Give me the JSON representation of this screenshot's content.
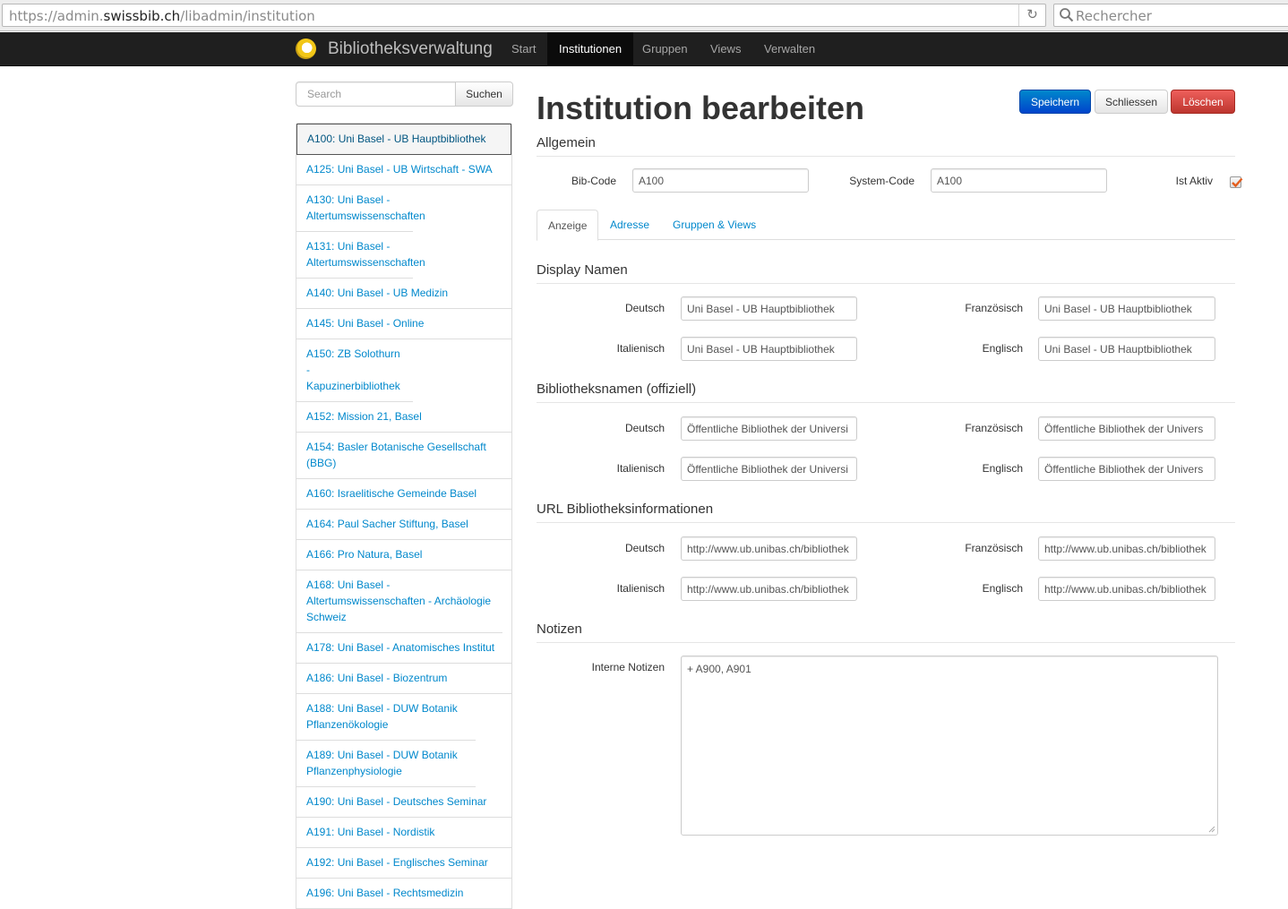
{
  "browser": {
    "url_prefix": "https://admin.",
    "url_host": "swissbib.ch",
    "url_path": "/libadmin/institution",
    "search_placeholder": "Rechercher"
  },
  "navbar": {
    "brand": "Bibliotheksverwaltung",
    "items": [
      "Start",
      "Institutionen",
      "Gruppen",
      "Views",
      "Verwalten"
    ],
    "active": "Institutionen"
  },
  "sidebar": {
    "search_placeholder": "Search",
    "search_button": "Suchen",
    "items": [
      "A100: Uni Basel - UB Hauptbibliothek",
      "A125: Uni Basel - UB Wirtschaft - SWA",
      "A130: Uni Basel - Altertumswissenschaften",
      "A131: Uni Basel - Altertumswissenschaften",
      "A140: Uni Basel - UB Medizin",
      "A145: Uni Basel - Online",
      "A150: ZB Solothurn - Kapuzinerbibliothek",
      "A152: Mission 21, Basel",
      "A154: Basler Botanische Gesellschaft (BBG)",
      "A160: Israelitische Gemeinde Basel",
      "A164: Paul Sacher Stiftung, Basel",
      "A166: Pro Natura, Basel",
      "A168: Uni Basel - Altertumswissenschaften - Archäologie Schweiz",
      "A178: Uni Basel - Anatomisches Institut",
      "A186: Uni Basel - Biozentrum",
      "A188: Uni Basel - DUW Botanik Pflanzenökologie",
      "A189: Uni Basel - DUW Botanik Pflanzenphysiologie",
      "A190: Uni Basel - Deutsches Seminar",
      "A191: Uni Basel - Nordistik",
      "A192: Uni Basel - Englisches Seminar",
      "A196: Uni Basel - Rechtsmedizin"
    ]
  },
  "main": {
    "title": "Institution bearbeiten",
    "buttons": {
      "save": "Speichern",
      "close": "Schliessen",
      "delete": "Löschen"
    },
    "general": {
      "legend": "Allgemein",
      "bibcode_label": "Bib-Code",
      "bibcode_value": "A100",
      "systemcode_label": "System-Code",
      "systemcode_value": "A100",
      "active_label": "Ist Aktiv",
      "active_checked": true
    },
    "tabs": [
      "Anzeige",
      "Adresse",
      "Gruppen & Views"
    ],
    "active_tab": "Anzeige",
    "lang_labels": {
      "de": "Deutsch",
      "fr": "Französisch",
      "it": "Italienisch",
      "en": "Englisch"
    },
    "display_names": {
      "legend": "Display Namen",
      "de": "Uni Basel - UB Hauptbibliothek",
      "fr": "Uni Basel - UB Hauptbibliothek",
      "it": "Uni Basel - UB Hauptbibliothek",
      "en": "Uni Basel - UB Hauptbibliothek"
    },
    "official_names": {
      "legend": "Bibliotheksnamen (offiziell)",
      "de": "Öffentliche Bibliothek der Universi",
      "fr": "Öffentliche Bibliothek der Univers",
      "it": "Öffentliche Bibliothek der Universi",
      "en": "Öffentliche Bibliothek der Univers"
    },
    "url_info": {
      "legend": "URL Bibliotheksinformationen",
      "de": "http://www.ub.unibas.ch/bibliothek",
      "fr": "http://www.ub.unibas.ch/bibliothek",
      "it": "http://www.ub.unibas.ch/bibliothek",
      "en": "http://www.ub.unibas.ch/bibliothek"
    },
    "notes": {
      "legend": "Notizen",
      "internal_label": "Interne Notizen",
      "internal_value": "+ A900, A901"
    }
  },
  "colors": {
    "navbar_bg": "#1f1f1f",
    "link": "#0088cc",
    "primary": "#0055cc",
    "danger": "#d9443c",
    "checkbox_mark": "#e45d1c"
  }
}
